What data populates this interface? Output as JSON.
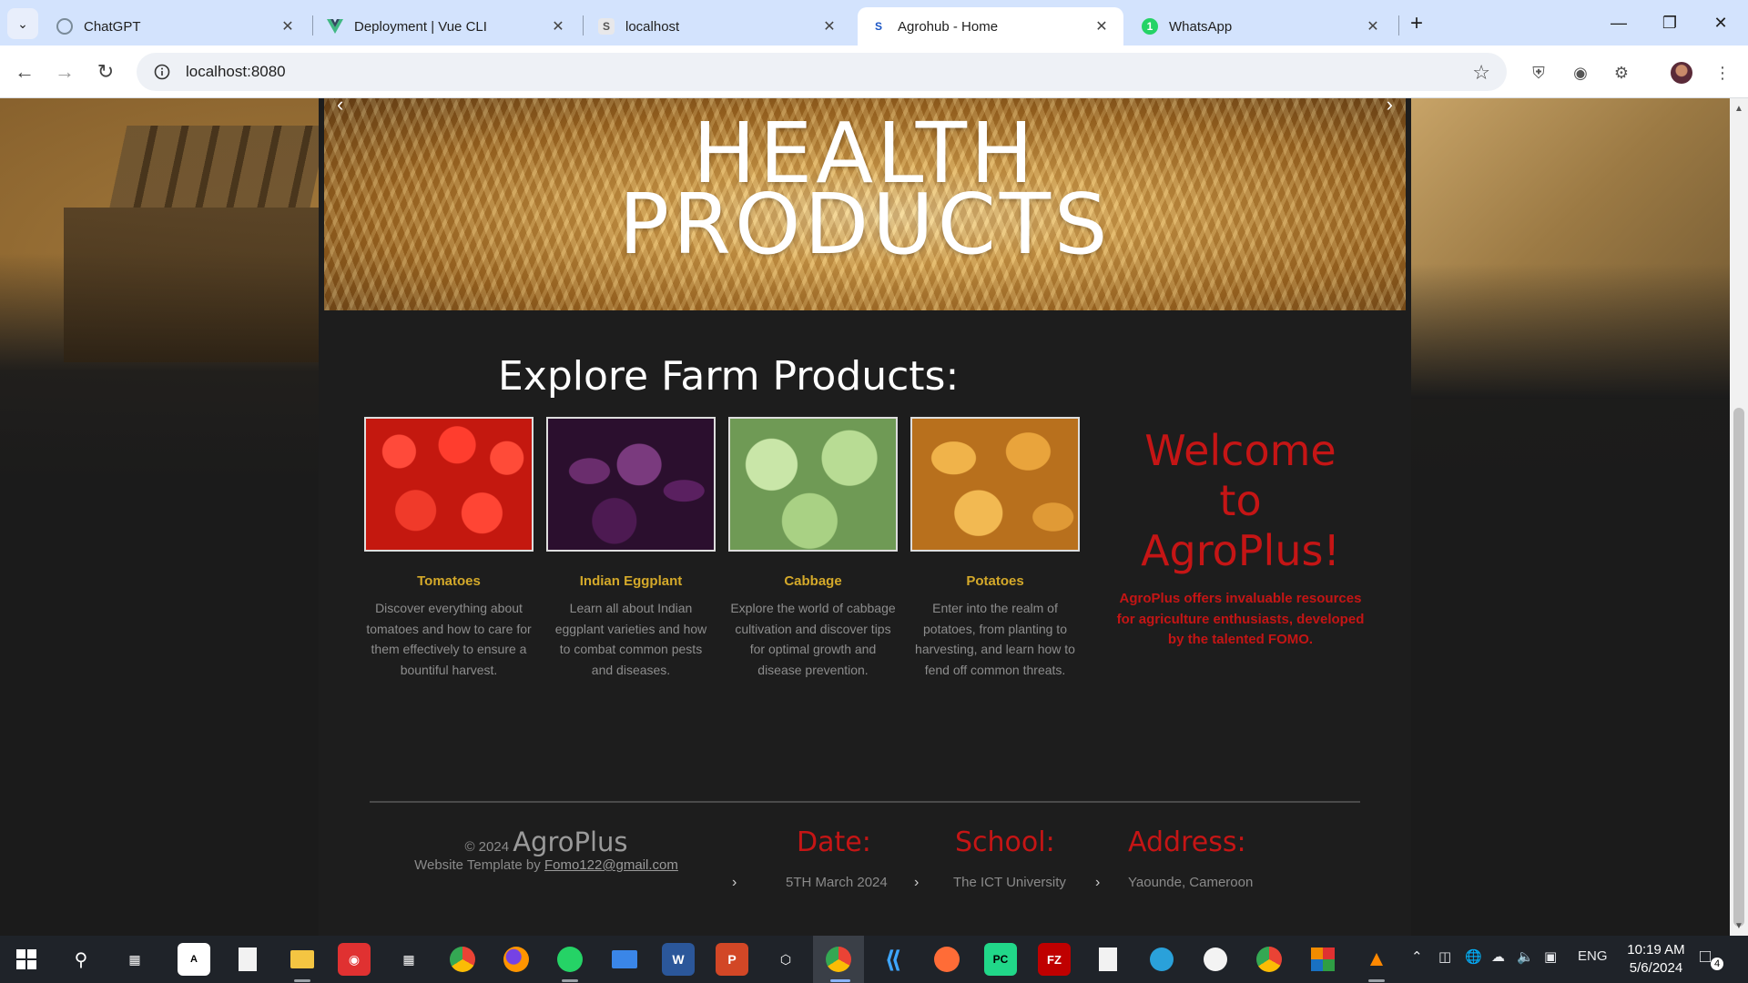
{
  "browser": {
    "tabs": [
      {
        "title": "ChatGPT",
        "favicon": "chatgpt-icon",
        "active": false
      },
      {
        "title": "Deployment | Vue CLI",
        "favicon": "vue-icon",
        "active": false
      },
      {
        "title": "localhost",
        "favicon": "s-letter-icon",
        "active": false
      },
      {
        "title": "Agrohub - Home",
        "favicon": "s-letter-icon",
        "active": true
      },
      {
        "title": "WhatsApp",
        "favicon": "whatsapp-icon",
        "active": false
      }
    ],
    "url": "localhost:8080"
  },
  "page": {
    "banner": {
      "line1": "HEALTH",
      "line2": "PRODUCTS"
    },
    "explore_title": "Explore Farm Products:",
    "products": [
      {
        "name": "Tomatoes",
        "description": "Discover everything about tomatoes and how to care for them effectively to ensure a bountiful harvest."
      },
      {
        "name": "Indian Eggplant",
        "description": "Learn all about Indian eggplant varieties and how to combat common pests and diseases."
      },
      {
        "name": "Cabbage",
        "description": "Explore the world of cabbage cultivation and discover tips for optimal growth and disease prevention."
      },
      {
        "name": "Potatoes",
        "description": "Enter into the realm of potatoes, from planting to harvesting, and learn how to fend off common threats."
      }
    ],
    "welcome": {
      "line1": "Welcome",
      "line2": "to",
      "line3": "AgroPlus!",
      "text": "AgroPlus offers invaluable resources for agriculture enthusiasts, developed by the talented FOMO."
    },
    "footer": {
      "copyright": "© 2024",
      "brand": "AgroPlus",
      "template_text": "Website Template by",
      "email": "Fomo122@gmail.com",
      "columns": [
        {
          "heading": "Date:",
          "value": "5TH March 2024"
        },
        {
          "heading": "School:",
          "value": "The ICT University"
        },
        {
          "heading": "Address:",
          "value": "Yaounde, Cameroon"
        }
      ]
    }
  },
  "taskbar": {
    "language": "ENG",
    "time": "10:19 AM",
    "date": "5/6/2024",
    "notifications": "4"
  },
  "colors": {
    "accent_red": "#c51515",
    "product_title": "#d4a92a",
    "tab_strip": "#d3e3fd"
  }
}
